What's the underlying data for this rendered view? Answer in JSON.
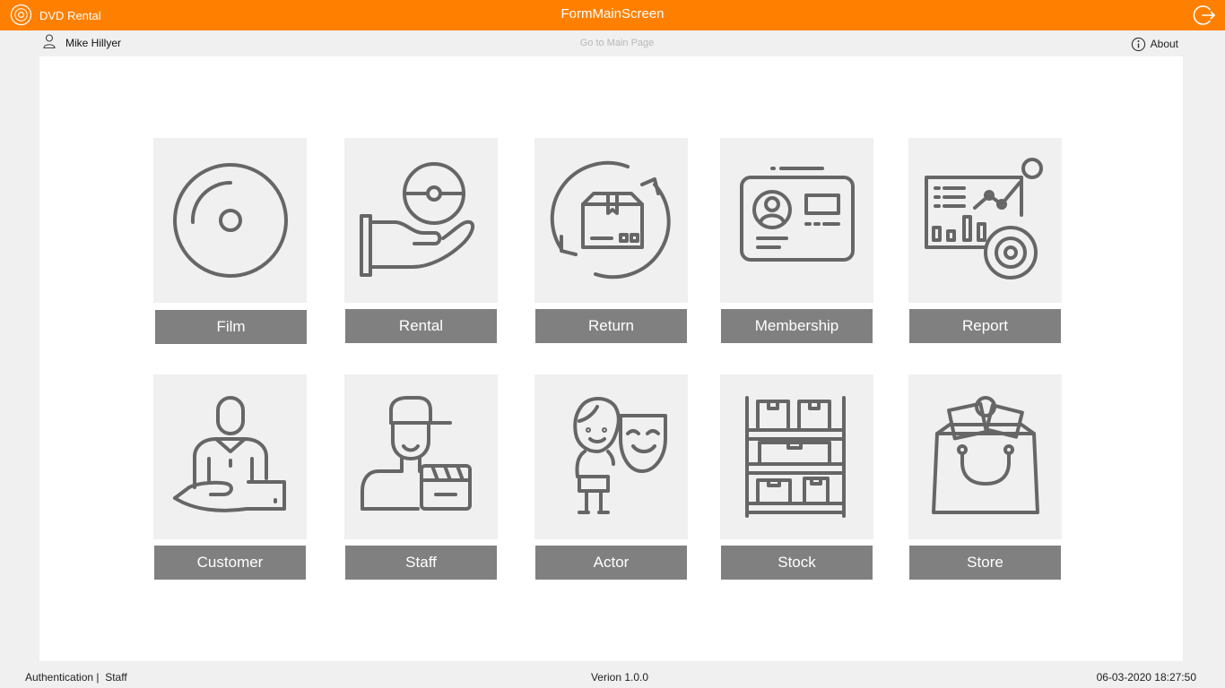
{
  "titlebar": {
    "app_name": "DVD Rental",
    "window_title": "FormMainScreen",
    "logo_icon": "disc-icon",
    "logout_icon": "logout-icon",
    "background_color": "#ff8000"
  },
  "topbar": {
    "user_icon": "user-icon",
    "user_name": "Mike Hillyer",
    "main_page_link": "Go to Main Page",
    "about_label": "About",
    "about_icon": "info-icon"
  },
  "tiles": [
    {
      "label": "Film",
      "icon": "disc-icon"
    },
    {
      "label": "Rental",
      "icon": "hand-disc-icon"
    },
    {
      "label": "Return",
      "icon": "box-return-icon"
    },
    {
      "label": "Membership",
      "icon": "id-card-icon"
    },
    {
      "label": "Report",
      "icon": "report-chart-icon"
    },
    {
      "label": "Customer",
      "icon": "customer-icon"
    },
    {
      "label": "Staff",
      "icon": "staff-icon"
    },
    {
      "label": "Actor",
      "icon": "actor-mask-icon"
    },
    {
      "label": "Stock",
      "icon": "shelf-icon"
    },
    {
      "label": "Store",
      "icon": "shopping-bag-icon"
    }
  ],
  "statusbar": {
    "auth_label": "Authentication |",
    "role": "Staff",
    "version": "Verion 1.0.0",
    "datetime": "06-03-2020 18:27:50"
  },
  "colors": {
    "accent": "#ff8000",
    "tile_background": "#f0f0f0",
    "button_background": "#808080",
    "icon_stroke": "#666666"
  }
}
